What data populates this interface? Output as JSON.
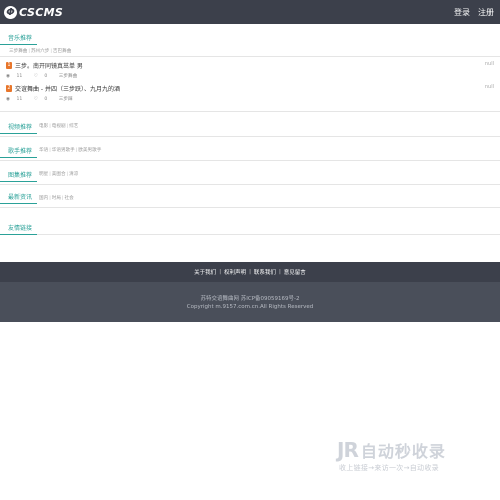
{
  "header": {
    "logo_mark": "Φ",
    "logo_text": "CSCMS",
    "login": "登录",
    "register": "注册"
  },
  "music": {
    "title": "音乐推荐",
    "tags": [
      "三步舞曲",
      "苏州六步",
      "吉巴舞曲"
    ],
    "songs": [
      {
        "rank": "1",
        "title": "三步。南开同镜真茁单 男",
        "views": "11",
        "likes": "0",
        "category": "三步舞曲",
        "extra": "null"
      },
      {
        "rank": "2",
        "title": "交谊舞曲 - 并四（三步跃）、九月九的酒",
        "views": "11",
        "likes": "0",
        "category": "三步踩",
        "extra": "null"
      }
    ]
  },
  "video": {
    "title": "视频推荐",
    "tags": [
      "电影",
      "电视剧",
      "综艺"
    ]
  },
  "singer": {
    "title": "歌手推荐",
    "tags": [
      "华语",
      "华语男歌手",
      "欧美男歌手"
    ]
  },
  "gallery": {
    "title": "图集推荐",
    "tags": [
      "明星",
      "美图合",
      "清凉"
    ]
  },
  "news": {
    "title": "最新资讯",
    "tags": [
      "国内",
      "时局",
      "社会"
    ]
  },
  "friends": {
    "title": "友情链接"
  },
  "footer": {
    "links": [
      "关于我们",
      "权利声明",
      "联系我们",
      "意见留言"
    ],
    "site_line": "苏特交谊舞曲网  苏ICP备09059169号-2",
    "copyright": "Copyright m.9157.com.cn.All Rights Reserved"
  },
  "watermark": {
    "logo": "JR",
    "brand": "自动秒收录",
    "sub": "收上链接→来访一次→自动收录"
  },
  "colors": {
    "header_bg": "#3c404b",
    "accent": "#2aa198",
    "rank": "#e8762b"
  }
}
